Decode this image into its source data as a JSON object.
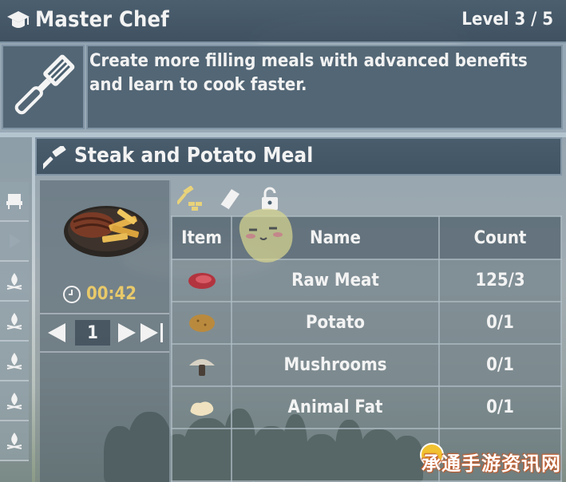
{
  "skill": {
    "title": "Master Chef",
    "level": "Level 3 / 5",
    "description": "Create more filling meals with advanced benefits and learn to cook faster."
  },
  "recipe": {
    "title": "Steak and Potato Meal",
    "cook_time": "00:42",
    "quantity": "1",
    "table": {
      "headers": {
        "item": "Item",
        "name": "Name",
        "count": "Count"
      },
      "rows": [
        {
          "icon": "raw-meat-icon",
          "name": "Raw Meat",
          "count": "125/3"
        },
        {
          "icon": "potato-icon",
          "name": "Potato",
          "count": "0/1"
        },
        {
          "icon": "mushroom-icon",
          "name": "Mushrooms",
          "count": "0/1"
        },
        {
          "icon": "animal-fat-icon",
          "name": "Animal Fat",
          "count": "0/1"
        }
      ]
    }
  },
  "watermark": "承通手游资讯网",
  "colors": {
    "timer": "#e8c96a",
    "panel": "#3a4e5e",
    "text": "#f3f3f3"
  }
}
